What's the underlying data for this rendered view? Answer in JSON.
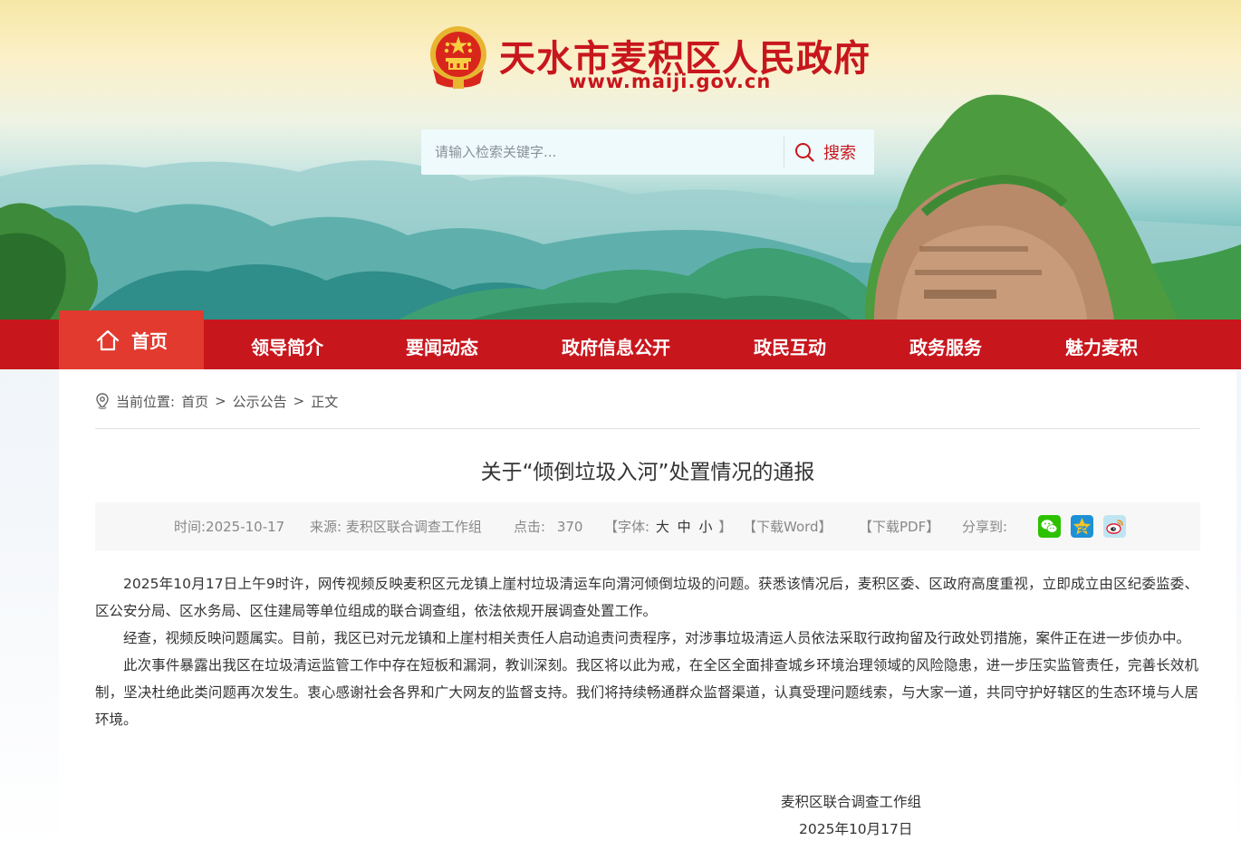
{
  "header": {
    "site_title": "天水市麦积区人民政府",
    "site_url": "www.maiji.gov.cn"
  },
  "search": {
    "placeholder": "请输入检索关键字...",
    "button_label": "搜索"
  },
  "nav": {
    "home_label": "首页",
    "items": [
      "领导简介",
      "要闻动态",
      "政府信息公开",
      "政民互动",
      "政务服务",
      "魅力麦积"
    ]
  },
  "breadcrumb": {
    "prefix": "当前位置:",
    "items": [
      "首页",
      "公示公告",
      "正文"
    ],
    "separator": ">"
  },
  "article": {
    "title": "关于“倾倒垃圾入河”处置情况的通报",
    "meta": {
      "time": "时间:2025-10-17",
      "source": "来源: 麦积区联合调查工作组",
      "clicks_label": "点击:",
      "clicks_value": "370",
      "font_label_open": "【字体:",
      "font_large": "大",
      "font_medium": "中",
      "font_small": "小",
      "font_label_close": "】",
      "download_word": "【下载Word】",
      "download_pdf": "【下载PDF】",
      "share_label": "分享到:"
    },
    "paragraphs": [
      "2025年10月17日上午9时许，网传视频反映麦积区元龙镇上崖村垃圾清运车向渭河倾倒垃圾的问题。获悉该情况后，麦积区委、区政府高度重视，立即成立由区纪委监委、区公安分局、区水务局、区住建局等单位组成的联合调查组，依法依规开展调查处置工作。",
      "经查，视频反映问题属实。目前，我区已对元龙镇和上崖村相关责任人启动追责问责程序，对涉事垃圾清运人员依法采取行政拘留及行政处罚措施，案件正在进一步侦办中。",
      "此次事件暴露出我区在垃圾清运监管工作中存在短板和漏洞，教训深刻。我区将以此为戒，在全区全面排查城乡环境治理领域的风险隐患，进一步压实监管责任，完善长效机制，坚决杜绝此类问题再次发生。衷心感谢社会各界和广大网友的监督支持。我们将持续畅通群众监督渠道，认真受理问题线索，与大家一道，共同守护好辖区的生态环境与人居环境。"
    ],
    "signature": "麦积区联合调查工作组",
    "date": "2025年10月17日"
  },
  "share_icons": [
    "wechat-icon",
    "qzone-icon",
    "weibo-icon"
  ],
  "colors": {
    "brand_red": "#c8161d",
    "nav_active": "#e23a2e",
    "wechat_green": "#2dc100",
    "qzone_blue": "#1e90d6",
    "weibo_bg": "#bfe5f2"
  }
}
